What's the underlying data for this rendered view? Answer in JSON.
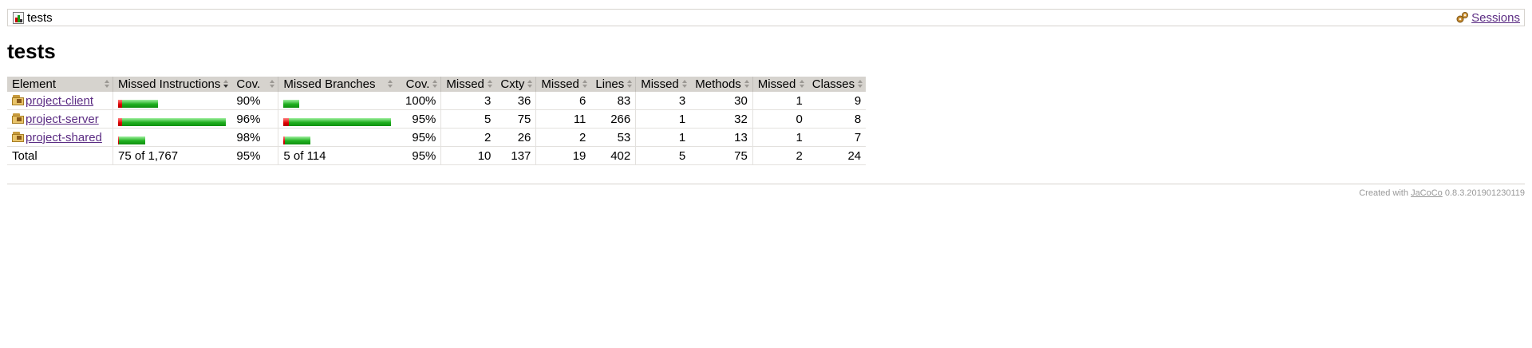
{
  "breadcrumb": {
    "title": "tests",
    "sessions_label": "Sessions"
  },
  "page_title": "tests",
  "table": {
    "headers": [
      "Element",
      "Missed Instructions",
      "Cov.",
      "Missed Branches",
      "Cov.",
      "Missed",
      "Cxty",
      "Missed",
      "Lines",
      "Missed",
      "Methods",
      "Missed",
      "Classes"
    ],
    "rows": [
      {
        "name": "project-client",
        "instr_cov_fraction": 0.9,
        "instr_cov": "90%",
        "branch_cov_fraction": 1.0,
        "branch_cov": "100%",
        "cxty_missed": "3",
        "cxty": "36",
        "lines_missed": "6",
        "lines": "83",
        "methods_missed": "3",
        "methods": "30",
        "classes_missed": "1",
        "classes": "9"
      },
      {
        "name": "project-server",
        "instr_cov_fraction": 0.96,
        "instr_cov": "96%",
        "branch_cov_fraction": 0.95,
        "branch_cov": "95%",
        "cxty_missed": "5",
        "cxty": "75",
        "lines_missed": "11",
        "lines": "266",
        "methods_missed": "1",
        "methods": "32",
        "classes_missed": "0",
        "classes": "8"
      },
      {
        "name": "project-shared",
        "instr_cov_fraction": 0.98,
        "instr_cov": "98%",
        "branch_cov_fraction": 0.95,
        "branch_cov": "95%",
        "cxty_missed": "2",
        "cxty": "26",
        "lines_missed": "2",
        "lines": "53",
        "methods_missed": "1",
        "methods": "13",
        "classes_missed": "1",
        "classes": "7"
      }
    ],
    "total": {
      "label": "Total",
      "instr": "75 of 1,767",
      "instr_cov": "95%",
      "branch": "5 of 114",
      "branch_cov": "95%",
      "cxty_missed": "10",
      "cxty": "137",
      "lines_missed": "19",
      "lines": "402",
      "methods_missed": "5",
      "methods": "75",
      "classes_missed": "2",
      "classes": "24"
    }
  },
  "footer": {
    "prefix": "Created with",
    "link": "JaCoCo",
    "version": "0.8.3.201901230119"
  },
  "colors": {
    "bar_missed": "#e00000",
    "bar_covered": "#1faf1f",
    "link": "#5b2c83",
    "header_bg": "#d6d3ce"
  }
}
